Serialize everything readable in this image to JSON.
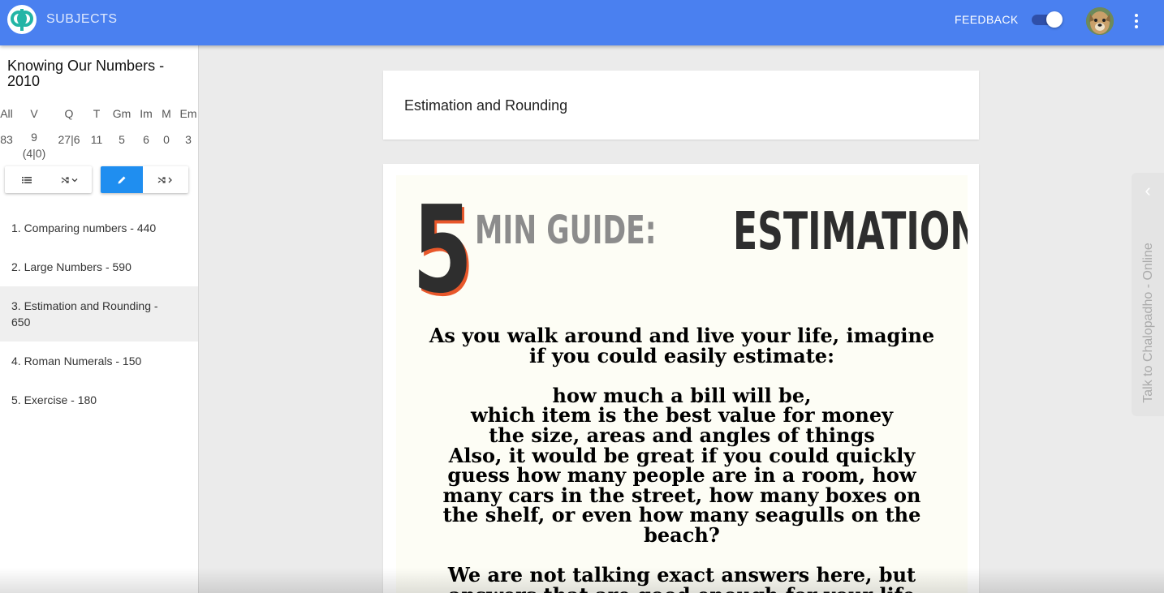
{
  "header": {
    "app_title": "SUBJECTS",
    "feedback_label": "FEEDBACK",
    "toggle_on": true,
    "brand_color": "#4a80f0"
  },
  "sidebar": {
    "chapter_title": "Knowing Our Numbers - 2010",
    "stats": [
      {
        "label": "All",
        "value": "83"
      },
      {
        "label": "V",
        "value": "9 (4|0)"
      },
      {
        "label": "Q",
        "value": "27|6"
      },
      {
        "label": "T",
        "value": "11"
      },
      {
        "label": "Gm",
        "value": "5"
      },
      {
        "label": "Im",
        "value": "6"
      },
      {
        "label": "M",
        "value": "0"
      },
      {
        "label": "Em",
        "value": "3"
      }
    ],
    "buttons": [
      {
        "icon": "list-icon",
        "glyph": "≡"
      },
      {
        "icon": "shuffle-dropdown-icon",
        "glyph": "⤮⌄"
      },
      {
        "icon": "edit-icon",
        "glyph": "✎",
        "active": true
      },
      {
        "icon": "shuffle-next-icon",
        "glyph": "⤮›"
      }
    ],
    "topics": [
      {
        "label": "1. Comparing numbers - 440"
      },
      {
        "label": "2. Large Numbers - 590"
      },
      {
        "label": "3. Estimation and Rounding - 650",
        "active": true
      },
      {
        "label": "4. Roman Numerals - 150"
      },
      {
        "label": "5. Exercise - 180"
      }
    ]
  },
  "main": {
    "topic_title": "Estimation and Rounding",
    "poster": {
      "number": "5",
      "subtitle": "MIN GUIDE:",
      "title": "ESTIMATION",
      "lines": [
        "As you walk around and live your life, imagine",
        "if you could easily estimate:",
        "",
        "how much a bill will be,",
        "which item is the best value for money",
        "the size, areas and angles of things",
        "Also, it would be great if you could quickly",
        "guess how many people are in a room, how",
        "many cars in the street, how many boxes on",
        "the shelf, or even how many seagulls on the",
        "beach?",
        "",
        "We are not talking exact answers here, but",
        "answers that are good enough for your life"
      ]
    }
  },
  "chat": {
    "label": "Talk to Chalopadho - Online",
    "chevron": "‹"
  }
}
